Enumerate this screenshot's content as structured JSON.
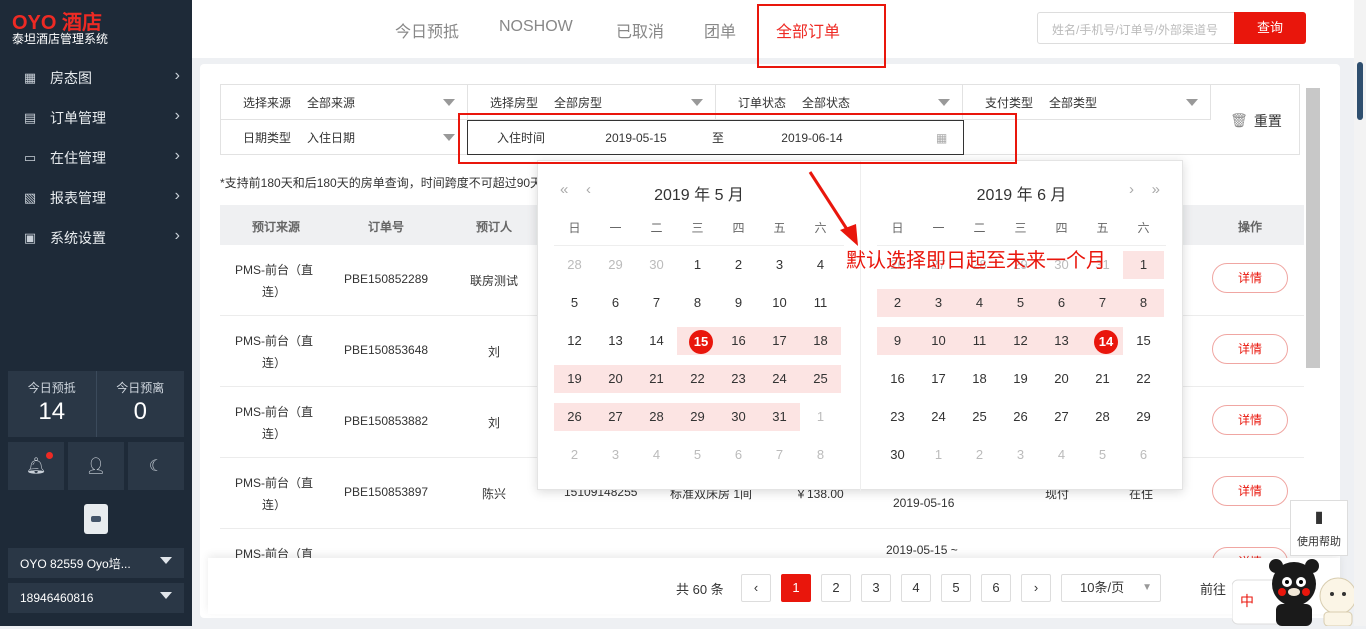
{
  "brand": {
    "logo": "OYO 酒店",
    "subtitle": "泰坦酒店管理系统"
  },
  "nav": [
    {
      "label": "房态图",
      "icon": "grid-icon"
    },
    {
      "label": "订单管理",
      "icon": "document-icon"
    },
    {
      "label": "在住管理",
      "icon": "bed-icon"
    },
    {
      "label": "报表管理",
      "icon": "chart-icon"
    },
    {
      "label": "系统设置",
      "icon": "monitor-icon"
    }
  ],
  "stats": {
    "arrive_label": "今日预抵",
    "arrive_value": "14",
    "depart_label": "今日预离",
    "depart_value": "0"
  },
  "hotel_select": "OYO 82559 Oyo培...",
  "phone_select": "18946460816",
  "tabs": [
    "今日预抵",
    "NOSHOW",
    "已取消",
    "团单",
    "全部订单"
  ],
  "search": {
    "placeholder": "姓名/手机号/订单号/外部渠道号",
    "button": "查询"
  },
  "filters": {
    "source": {
      "label": "选择来源",
      "value": "全部来源"
    },
    "room_type": {
      "label": "选择房型",
      "value": "全部房型"
    },
    "order_status": {
      "label": "订单状态",
      "value": "全部状态"
    },
    "pay_type": {
      "label": "支付类型",
      "value": "全部类型"
    },
    "date_type": {
      "label": "日期类型",
      "value": "入住日期"
    },
    "checkin": {
      "label": "入住时间",
      "start": "2019-05-15",
      "sep": "至",
      "end": "2019-06-14"
    },
    "reset": "重置"
  },
  "note": "*支持前180天和后180天的房单查询，时间跨度不可超过90天",
  "table": {
    "headers": {
      "source": "预订来源",
      "order_no": "订单号",
      "booker": "预订人",
      "action": "操作"
    },
    "rows": [
      {
        "source": "PMS-前台（直连）",
        "order_no": "PBE150852289",
        "booker": "联房测试",
        "action": "详情"
      },
      {
        "source": "PMS-前台（直连）",
        "order_no": "PBE150853648",
        "booker": "刘",
        "action": "详情"
      },
      {
        "source": "PMS-前台（直连）",
        "order_no": "PBE150853882",
        "booker": "刘",
        "action": "详情"
      },
      {
        "source": "PMS-前台（直连）",
        "order_no": "PBE150853897",
        "booker": "陈兴",
        "phone": "15109148255",
        "room": "标准双床房 1间",
        "price": "￥138.00",
        "date": "2019-05-16",
        "pay": "现付",
        "status": "在住",
        "action": "详情"
      },
      {
        "source": "PMS-前台（直连）",
        "order_no": "",
        "booker": "",
        "date": "2019-05-15 ~",
        "action": "详情"
      }
    ]
  },
  "pager": {
    "total": "共 60 条",
    "pages": [
      "1",
      "2",
      "3",
      "4",
      "5",
      "6"
    ],
    "page_size": "10条/页",
    "goto": "前往"
  },
  "calendar": {
    "weekdays": [
      "日",
      "一",
      "二",
      "三",
      "四",
      "五",
      "六"
    ],
    "left": {
      "title": "2019 年 5 月",
      "days": [
        [
          "28",
          "29",
          "30",
          "1",
          "2",
          "3",
          "4"
        ],
        [
          "5",
          "6",
          "7",
          "8",
          "9",
          "10",
          "11"
        ],
        [
          "12",
          "13",
          "14",
          "15",
          "16",
          "17",
          "18"
        ],
        [
          "19",
          "20",
          "21",
          "22",
          "23",
          "24",
          "25"
        ],
        [
          "26",
          "27",
          "28",
          "29",
          "30",
          "31",
          "1"
        ],
        [
          "2",
          "3",
          "4",
          "5",
          "6",
          "7",
          "8"
        ]
      ]
    },
    "right": {
      "title": "2019 年 6 月",
      "days": [
        [
          "26",
          "27",
          "28",
          "29",
          "30",
          "31",
          "1"
        ],
        [
          "2",
          "3",
          "4",
          "5",
          "6",
          "7",
          "8"
        ],
        [
          "9",
          "10",
          "11",
          "12",
          "13",
          "14",
          "15"
        ],
        [
          "16",
          "17",
          "18",
          "19",
          "20",
          "21",
          "22"
        ],
        [
          "23",
          "24",
          "25",
          "26",
          "27",
          "28",
          "29"
        ],
        [
          "30",
          "1",
          "2",
          "3",
          "4",
          "5",
          "6"
        ]
      ]
    }
  },
  "annotation": "默认选择即日起至未来一个月",
  "help": "使用帮助",
  "mascot_text": "中"
}
